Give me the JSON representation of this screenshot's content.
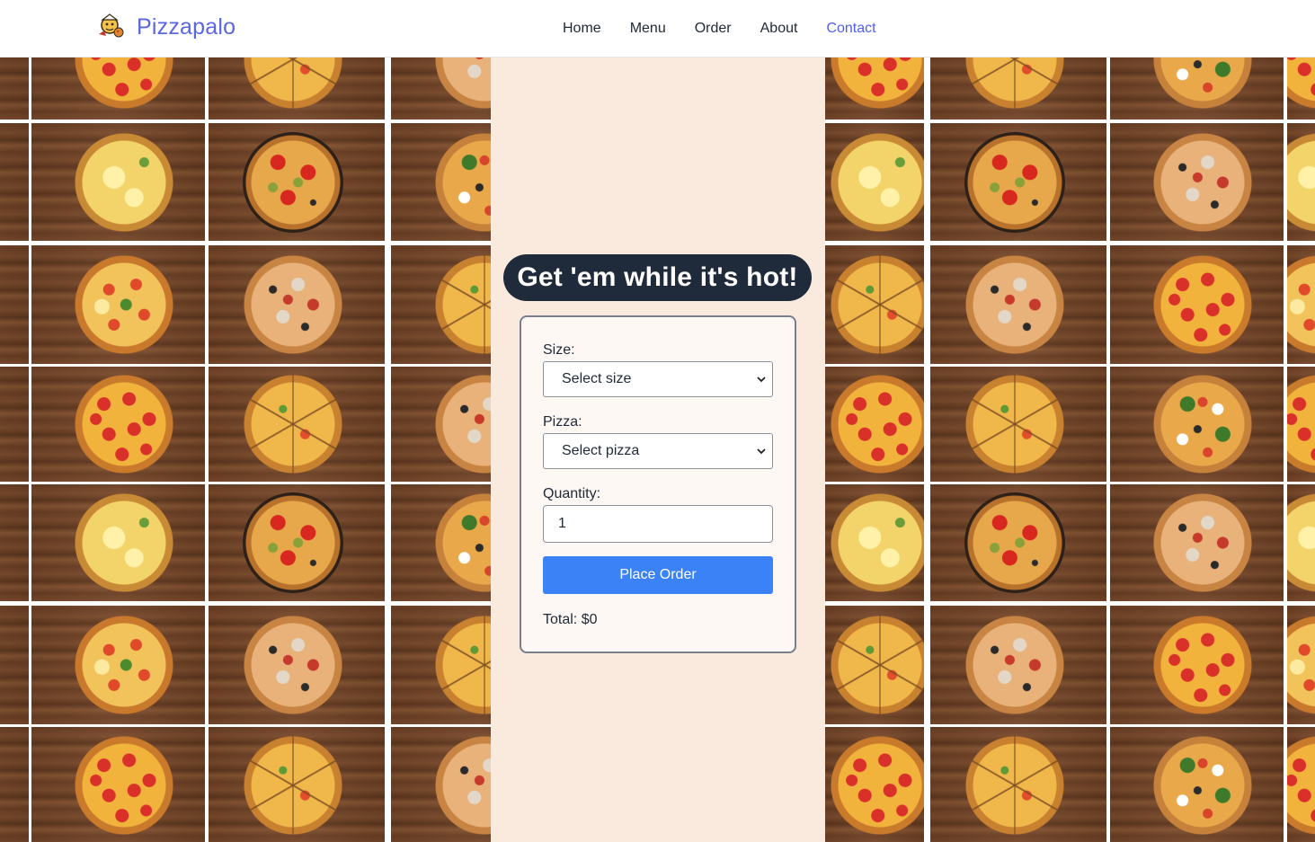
{
  "header": {
    "brand": "Pizzapalo",
    "logo_icon": "pizza-chef-icon",
    "nav": [
      {
        "label": "Home",
        "active": false
      },
      {
        "label": "Menu",
        "active": false
      },
      {
        "label": "Order",
        "active": false
      },
      {
        "label": "About",
        "active": false
      },
      {
        "label": "Contact",
        "active": true
      }
    ],
    "brand_color": "#5a67e0",
    "active_color": "#4f5ff0"
  },
  "hero": {
    "headline": "Get 'em while it's hot!"
  },
  "order_form": {
    "size_label": "Size:",
    "size_value": "Select size",
    "pizza_label": "Pizza:",
    "pizza_value": "Select pizza",
    "quantity_label": "Quantity:",
    "quantity_value": "1",
    "submit_label": "Place Order",
    "total_text": "Total: $0",
    "button_color": "#3b82f6"
  },
  "background": {
    "pizza_variants": [
      "veggie",
      "pepperoni",
      "sliced",
      "supreme",
      "cheese",
      "redpepper",
      "margherita"
    ]
  }
}
